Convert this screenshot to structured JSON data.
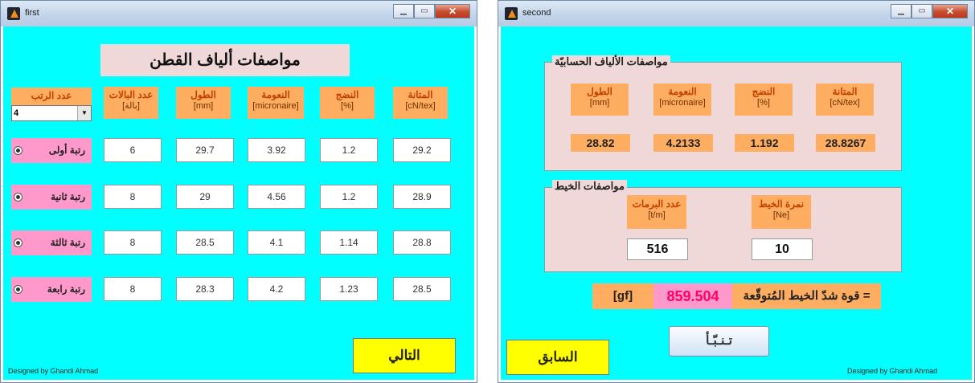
{
  "first": {
    "window_title": "first",
    "heading": "مواصفات ألياف القطن",
    "grade_count": {
      "label": "عدد الرتب",
      "value": "4"
    },
    "columns": [
      {
        "ar": "عدد البالات",
        "unit": "[بالة]"
      },
      {
        "ar": "الطول",
        "unit": "[mm]"
      },
      {
        "ar": "النعومة",
        "unit": "[micronaire]"
      },
      {
        "ar": "النضج",
        "unit": "[%]"
      },
      {
        "ar": "المتانة",
        "unit": "[cN/tex]"
      }
    ],
    "rows": [
      {
        "label": "رتبة أولى",
        "values": [
          "6",
          "29.7",
          "3.92",
          "1.2",
          "29.2"
        ]
      },
      {
        "label": "رتبة ثانية",
        "values": [
          "8",
          "29",
          "4.56",
          "1.2",
          "28.9"
        ]
      },
      {
        "label": "رتبة ثالثة",
        "values": [
          "8",
          "28.5",
          "4.1",
          "1.14",
          "28.8"
        ]
      },
      {
        "label": "رتبة رابعة",
        "values": [
          "8",
          "28.3",
          "4.2",
          "1.23",
          "28.5"
        ]
      }
    ],
    "next_button": "التالي",
    "credit": "Designed by Ghandi Ahmad"
  },
  "second": {
    "window_title": "second",
    "fiber_panel_title": "مواصفات الألياف الحسابيّة",
    "fiber_columns": [
      {
        "ar": "الطول",
        "unit": "[mm]",
        "value": "28.82"
      },
      {
        "ar": "النعومة",
        "unit": "[micronaire]",
        "value": "4.2133"
      },
      {
        "ar": "النضج",
        "unit": "[%]",
        "value": "1.192"
      },
      {
        "ar": "المتانة",
        "unit": "[cN/tex]",
        "value": "28.8267"
      }
    ],
    "yarn_panel_title": "مواصفات الخيط",
    "yarn_fields": [
      {
        "ar": "عدد البرمات",
        "unit": "[t/m]",
        "value": "516"
      },
      {
        "ar": "نمرة الخيط",
        "unit": "[Ne]",
        "value": "10"
      }
    ],
    "result": {
      "label": "قوة شدّ الخيط المُتوقّعة =",
      "value": "859.504",
      "unit": "[gf]"
    },
    "predict_button": "تـنـبّـأ",
    "previous_button": "السابق",
    "credit": "Designed by Ghandi Ahmad"
  },
  "colors": {
    "background": "#00ffff",
    "label": "#ffad60",
    "row_label": "#ff99cc",
    "button": "#ffff00",
    "panel": "#f0d8d8",
    "result_value": "#ff0066"
  }
}
